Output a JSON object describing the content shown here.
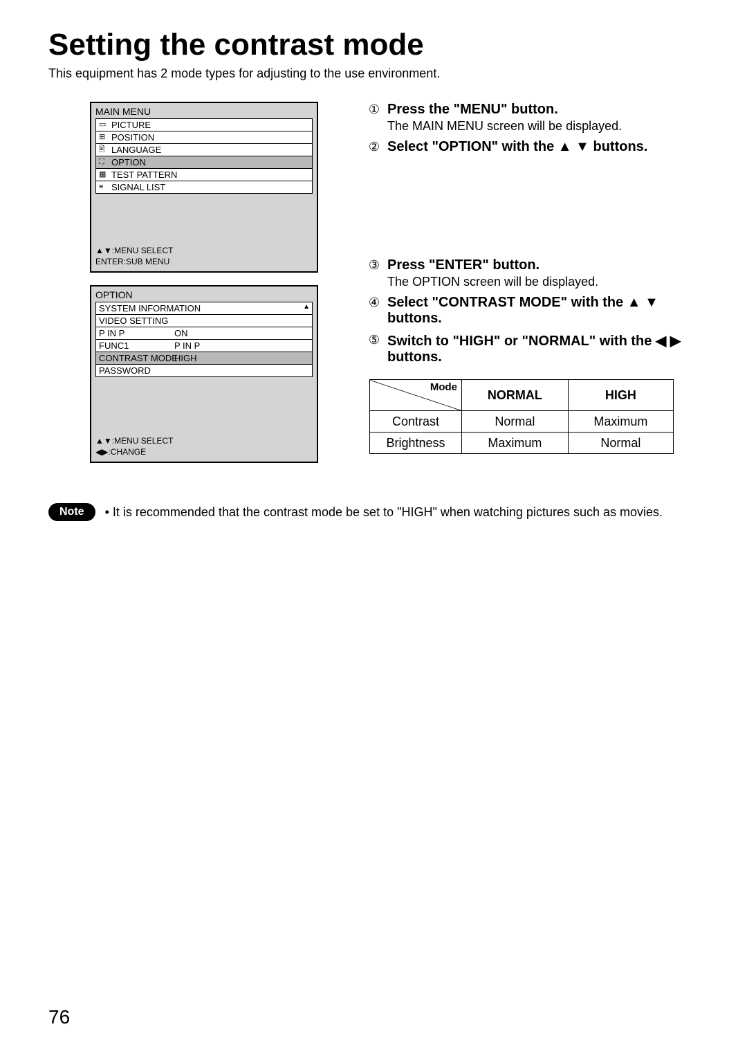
{
  "title": "Setting the contrast mode",
  "intro": "This equipment has 2 mode types for adjusting to the use environment.",
  "main_menu": {
    "title": "MAIN MENU",
    "items": [
      {
        "label": "PICTURE",
        "icon": "▭",
        "sel": false
      },
      {
        "label": "POSITION",
        "icon": "⊞",
        "sel": false
      },
      {
        "label": "LANGUAGE",
        "icon": "🖹",
        "sel": false
      },
      {
        "label": "OPTION",
        "icon": "⛶",
        "sel": true
      },
      {
        "label": "TEST PATTERN",
        "icon": "▦",
        "sel": false
      },
      {
        "label": "SIGNAL LIST",
        "icon": "≡",
        "sel": false
      }
    ],
    "footer1": "▲▼:MENU SELECT",
    "footer2": "ENTER:SUB MENU"
  },
  "option_menu": {
    "title": "OPTION",
    "items": [
      {
        "label": "SYSTEM INFORMATION",
        "value": "",
        "sel": false
      },
      {
        "label": "VIDEO SETTING",
        "value": "",
        "sel": false
      },
      {
        "label": "P IN P",
        "value": "ON",
        "sel": false
      },
      {
        "label": "FUNC1",
        "value": "P IN P",
        "sel": false
      },
      {
        "label": "CONTRAST MODE",
        "value": "HIGH",
        "sel": true
      },
      {
        "label": "PASSWORD",
        "value": "",
        "sel": false
      }
    ],
    "footer1": "▲▼:MENU SELECT",
    "footer2": "◀▶:CHANGE"
  },
  "steps": {
    "s1": {
      "num": "①",
      "title": "Press the \"MENU\" button.",
      "sub": "The MAIN MENU screen will be displayed."
    },
    "s2": {
      "num": "②",
      "title": "Select \"OPTION\" with the  ▲  ▼ buttons."
    },
    "s3": {
      "num": "③",
      "title": "Press \"ENTER\" button.",
      "sub": "The OPTION screen will be displayed."
    },
    "s4": {
      "num": "④",
      "title": "Select \"CONTRAST MODE\" with the ▲  ▼  buttons."
    },
    "s5": {
      "num": "⑤",
      "title": "Switch to \"HIGH\" or \"NORMAL\" with the  ◀  ▶  buttons."
    }
  },
  "table": {
    "corner": "Mode",
    "cols": [
      "NORMAL",
      "HIGH"
    ],
    "rows": [
      {
        "label": "Contrast",
        "values": [
          "Normal",
          "Maximum"
        ]
      },
      {
        "label": "Brightness",
        "values": [
          "Maximum",
          "Normal"
        ]
      }
    ]
  },
  "note": {
    "badge": "Note",
    "text": "• It is recommended that the contrast mode be set to \"HIGH\" when watching pictures such as movies."
  },
  "page_number": "76"
}
